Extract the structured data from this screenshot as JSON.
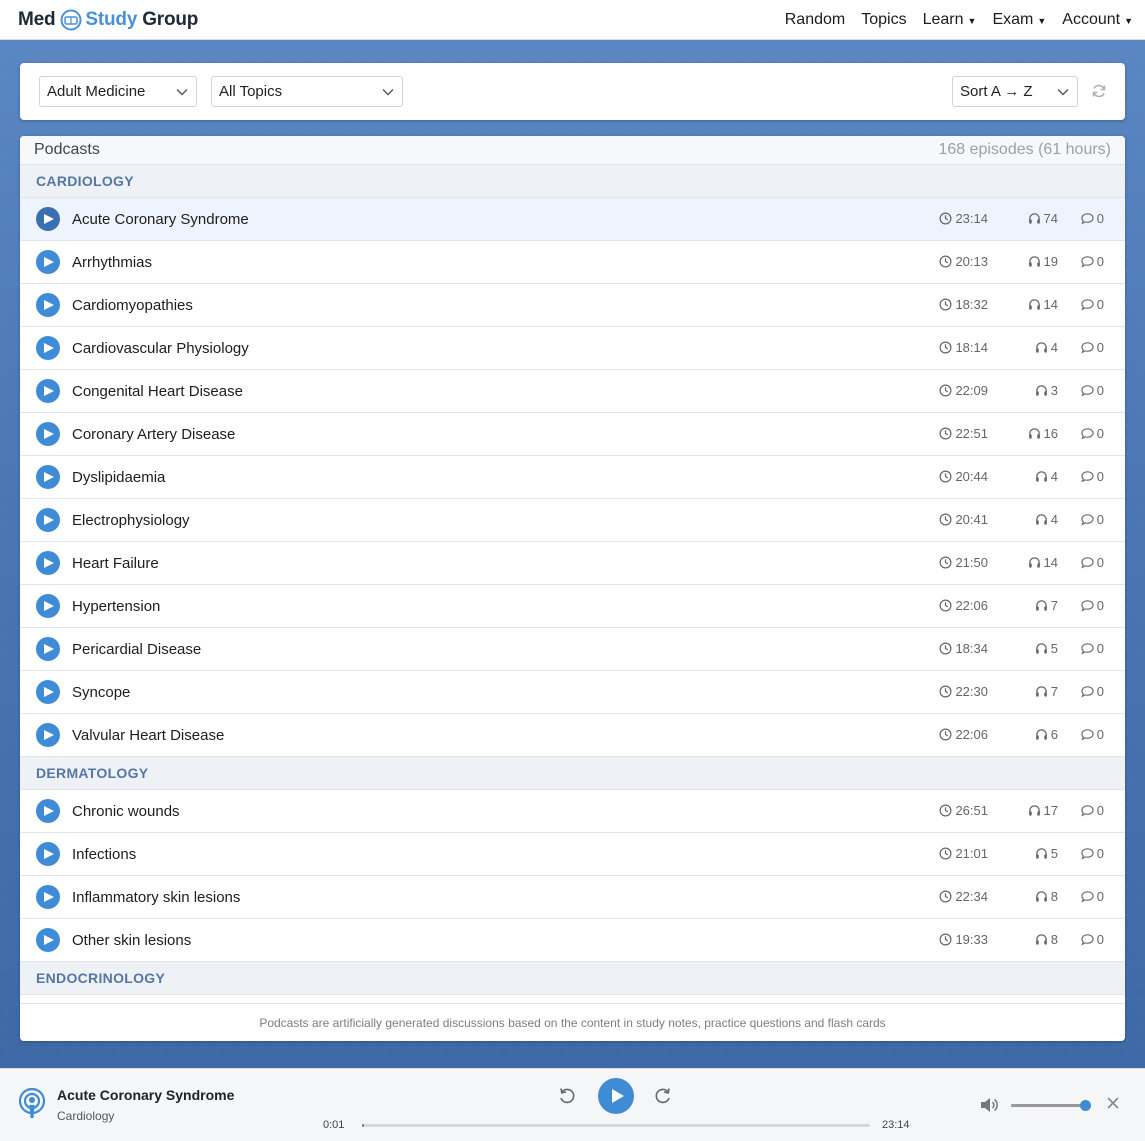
{
  "nav": {
    "logo_med": "Med",
    "logo_study": "Study",
    "logo_group": "Group",
    "items": [
      {
        "label": "Random",
        "has_caret": false
      },
      {
        "label": "Topics",
        "has_caret": false
      },
      {
        "label": "Learn",
        "has_caret": true
      },
      {
        "label": "Exam",
        "has_caret": true
      },
      {
        "label": "Account",
        "has_caret": true
      }
    ]
  },
  "filters": {
    "specialty": "Adult Medicine",
    "topic": "All Topics",
    "sort": "Sort A → Z",
    "refresh_icon": "refresh-icon"
  },
  "panel": {
    "title": "Podcasts",
    "summary": "168 episodes (61 hours)",
    "footer": "Podcasts are artificially generated discussions based on the content in study notes, practice questions and flash cards"
  },
  "categories": [
    {
      "name": "CARDIOLOGY",
      "episodes": [
        {
          "title": "Acute Coronary Syndrome",
          "duration": "23:14",
          "listens": "74",
          "comments": "0",
          "active": true
        },
        {
          "title": "Arrhythmias",
          "duration": "20:13",
          "listens": "19",
          "comments": "0"
        },
        {
          "title": "Cardiomyopathies",
          "duration": "18:32",
          "listens": "14",
          "comments": "0"
        },
        {
          "title": "Cardiovascular Physiology",
          "duration": "18:14",
          "listens": "4",
          "comments": "0"
        },
        {
          "title": "Congenital Heart Disease",
          "duration": "22:09",
          "listens": "3",
          "comments": "0"
        },
        {
          "title": "Coronary Artery Disease",
          "duration": "22:51",
          "listens": "16",
          "comments": "0"
        },
        {
          "title": "Dyslipidaemia",
          "duration": "20:44",
          "listens": "4",
          "comments": "0"
        },
        {
          "title": "Electrophysiology",
          "duration": "20:41",
          "listens": "4",
          "comments": "0"
        },
        {
          "title": "Heart Failure",
          "duration": "21:50",
          "listens": "14",
          "comments": "0"
        },
        {
          "title": "Hypertension",
          "duration": "22:06",
          "listens": "7",
          "comments": "0"
        },
        {
          "title": "Pericardial Disease",
          "duration": "18:34",
          "listens": "5",
          "comments": "0"
        },
        {
          "title": "Syncope",
          "duration": "22:30",
          "listens": "7",
          "comments": "0"
        },
        {
          "title": "Valvular Heart Disease",
          "duration": "22:06",
          "listens": "6",
          "comments": "0"
        }
      ]
    },
    {
      "name": "DERMATOLOGY",
      "episodes": [
        {
          "title": "Chronic wounds",
          "duration": "26:51",
          "listens": "17",
          "comments": "0"
        },
        {
          "title": "Infections",
          "duration": "21:01",
          "listens": "5",
          "comments": "0"
        },
        {
          "title": "Inflammatory skin lesions",
          "duration": "22:34",
          "listens": "8",
          "comments": "0"
        },
        {
          "title": "Other skin lesions",
          "duration": "19:33",
          "listens": "8",
          "comments": "0"
        }
      ]
    },
    {
      "name": "ENDOCRINOLOGY",
      "episodes": []
    }
  ],
  "player": {
    "title": "Acute Coronary Syndrome",
    "subtitle": "Cardiology",
    "current_time": "0:01",
    "total_time": "23:14",
    "progress_fraction": 0.001,
    "volume_fraction": 1.0
  },
  "colors": {
    "accent": "#3f8bd6",
    "category_text": "#5577a3",
    "background_top": "#5a86c2",
    "background_bottom": "#3f69a6"
  }
}
